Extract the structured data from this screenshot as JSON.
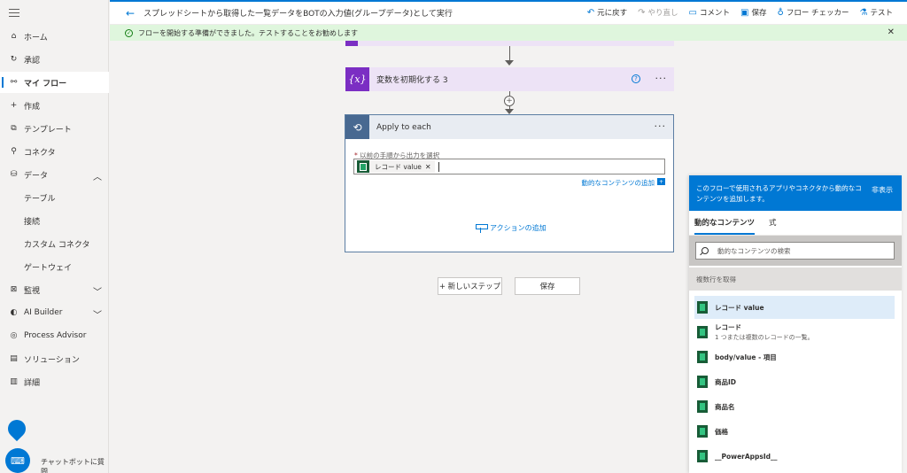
{
  "nav": {
    "items": [
      {
        "label": "ホーム",
        "icon": "home-icon",
        "glyph": "⌂"
      },
      {
        "label": "承認",
        "icon": "approvals-icon",
        "glyph": "↻"
      },
      {
        "label": "マイ フロー",
        "icon": "flow-icon",
        "glyph": "⚯"
      },
      {
        "label": "作成",
        "icon": "plus-icon",
        "glyph": "+"
      },
      {
        "label": "テンプレート",
        "icon": "template-icon",
        "glyph": "⧉"
      },
      {
        "label": "コネクタ",
        "icon": "connector-icon",
        "glyph": "⚲"
      },
      {
        "label": "データ",
        "icon": "database-icon",
        "glyph": "⛁"
      },
      {
        "label": "テーブル"
      },
      {
        "label": "接続"
      },
      {
        "label": "カスタム コネクタ"
      },
      {
        "label": "ゲートウェイ"
      },
      {
        "label": "監視",
        "icon": "monitor-icon",
        "glyph": "⊠"
      },
      {
        "label": "AI Builder",
        "icon": "ai-builder-icon",
        "glyph": "◐"
      },
      {
        "label": "Process Advisor",
        "icon": "process-advisor-icon",
        "glyph": "◎"
      },
      {
        "label": "ソリューション",
        "icon": "solution-icon",
        "glyph": "▤"
      },
      {
        "label": "詳細",
        "icon": "book-icon",
        "glyph": "▥"
      }
    ],
    "chatbot_label": "チャットボットに質問"
  },
  "topbar": {
    "title": "スプレッドシートから取得した一覧データをBOTの入力値(グループデータ)として実行",
    "actions": {
      "undo": "元に戻す",
      "redo": "やり直し",
      "comment": "コメント",
      "save": "保存",
      "checker": "フロー チェッカー",
      "test": "テスト"
    }
  },
  "banner": {
    "text": "フローを開始する準備ができました。テストすることをお勧めします"
  },
  "canvas": {
    "var_card_title": "変数を初期化する 3",
    "var_card_icon_text": "{x}",
    "apply_title": "Apply to each",
    "field_label": "以前の手順から出力を選択",
    "field_required": "*",
    "token_label": "レコード value",
    "dynamic_link": "動的なコンテンツの追加",
    "add_action": "アクションの追加",
    "new_step": "+ 新しいステップ",
    "save": "保存"
  },
  "dynamic_panel": {
    "header_text": "このフローで使用されるアプリやコネクタから動的なコンテンツを追加します。",
    "hide_label": "非表示",
    "tabs": [
      "動的なコンテンツ",
      "式"
    ],
    "search_placeholder": "動的なコンテンツの検索",
    "group_title": "複数行を取得",
    "items": [
      {
        "name": "レコード value",
        "desc": ""
      },
      {
        "name": "レコード",
        "desc": "1 つまたは複数のレコードの一覧。"
      },
      {
        "name": "body/value - 項目",
        "desc": ""
      },
      {
        "name": "商品ID",
        "desc": ""
      },
      {
        "name": "商品名",
        "desc": ""
      },
      {
        "name": "価格",
        "desc": ""
      },
      {
        "name": "__PowerAppsId__",
        "desc": ""
      }
    ]
  },
  "colors": {
    "accent": "#0078d4",
    "variable": "#7b2ec3",
    "apply_to_each": "#486991",
    "excel": "#185c37",
    "banner": "#dff6dd"
  }
}
